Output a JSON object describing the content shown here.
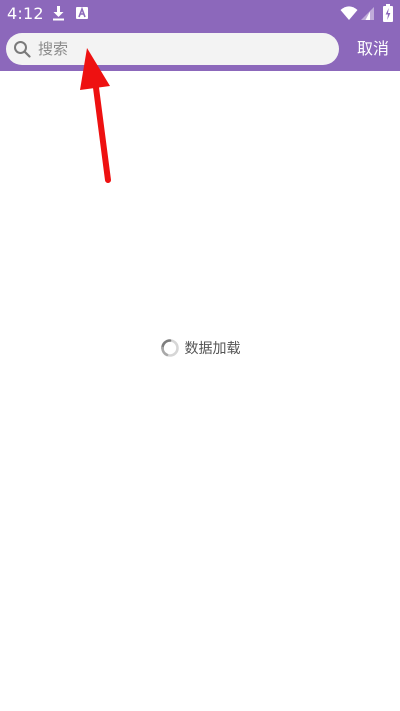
{
  "status_bar": {
    "time": "4:12",
    "icons": [
      "download-icon",
      "text-a-icon",
      "wifi-icon",
      "cellular-signal-icon",
      "battery-charging-icon"
    ]
  },
  "search": {
    "placeholder": "搜索",
    "value": "",
    "icon": "search-icon"
  },
  "toolbar": {
    "cancel_label": "取消"
  },
  "loading": {
    "text": "数据加载",
    "icon": "spinner-icon"
  },
  "annotation": {
    "arrow_color": "#ee1111",
    "icon": "red-arrow-icon"
  },
  "colors": {
    "primary": "#8c68bb",
    "search_background": "#f3f3f3",
    "white": "#ffffff"
  }
}
